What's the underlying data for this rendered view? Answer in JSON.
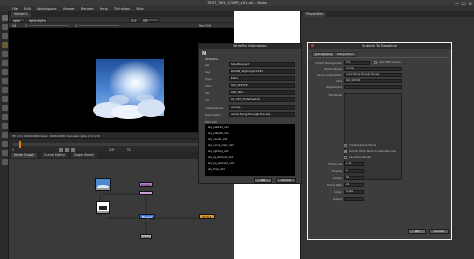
{
  "window": {
    "title": "TEST_SKY_COMP_v01.nk - Nuke",
    "controls": [
      "—",
      "☐",
      "✕"
    ]
  },
  "menubar": [
    "File",
    "Edit",
    "Workspace",
    "Viewer",
    "Render",
    "Help",
    "Thinkbox",
    "Misc"
  ],
  "viewer": {
    "tab_label": "Viewer1",
    "channels": "rgba",
    "channel_value": "rgba.alpha",
    "zoom": "1:1",
    "proxy": "2D",
    "frame": "f/8",
    "gain": "1",
    "gamma": "1",
    "lut": "Rec709",
    "footer": "f/8 | 2:1  1920x1080 bbox: 1920x1080 channels: rgba  x=0 y=0"
  },
  "timeline": {
    "ctrl_labels": [
      "1",
      "24*",
      "TC"
    ]
  },
  "node_graph": {
    "tabs": [
      "Node Graph",
      "Curve Editor",
      "Dope Sheet"
    ],
    "nodes": {
      "read1": "Read1",
      "read2": "Read2",
      "grade": "Grade1",
      "merge": "Merge1",
      "write": "Write1",
      "viewer": "Viewer1"
    }
  },
  "properties": {
    "tab_label": "Properties"
  },
  "info_dialog": {
    "title": "WriteFile Information",
    "logo": "N",
    "section": "WriteFile",
    "fields": [
      {
        "label": "Job",
        "value": "SkyeBuoyant"
      },
      {
        "label": "Seq",
        "value": "DOWN_Skybright-2013"
      },
      {
        "label": "Type",
        "value": "Elem"
      },
      {
        "label": "Shot",
        "value": "SKY_SHOT#"
      },
      {
        "label": "Ver",
        "value": "001_001"
      },
      {
        "label": "Src",
        "value": "01_SKY_FluteFeedv9"
      },
      {
        "label": "Create Name",
        "value": "vcomp"
      },
      {
        "label": "Description",
        "value": "comp flying through the sky"
      },
      {
        "label": "OUT List",
        "value": ""
      }
    ],
    "list_lines": [
      "sky_plate01_v01",
      "sky_plate02_v01",
      "sky_clouds_v02",
      "sky_comp_main_v03",
      "sky_lighting_v01",
      "sky_fg_element_v01",
      "sky_bg_element_v02",
      "sky_final_v04"
    ],
    "buttons": {
      "ok": "OK",
      "cancel": "Cancel"
    }
  },
  "deadline_dialog": {
    "title": "Submit To Deadline",
    "tabs": [
      "Job Options",
      "Integration"
    ],
    "fields": [
      {
        "label": "Project Management",
        "value": "FTL"
      },
      {
        "label": "Version Name",
        "value": "vcomp"
      },
      {
        "label": "Version Description",
        "value": "comp flying through the sky"
      },
      {
        "label": "Shot",
        "value": "SKY_SHOT#"
      },
      {
        "label": "Department",
        "value": ""
      },
      {
        "label": "Thumbnail",
        "value": ""
      }
    ],
    "add_version_label": "Add AMF Version",
    "options": [
      {
        "label": "Create/Upload Movie"
      },
      {
        "label": "Submit Write Node As Separate Jobs"
      },
      {
        "label": "Use Nuke Render"
      }
    ],
    "lower_fields": [
      {
        "label": "Frame List",
        "value": "1-24"
      },
      {
        "label": "Threads",
        "value": "0"
      },
      {
        "label": "Quality",
        "value": "50"
      },
      {
        "label": "Frame Rate",
        "value": "24"
      },
      {
        "label": "Codec",
        "value": "H.264"
      },
      {
        "label": "Output",
        "value": ""
      }
    ],
    "buttons": {
      "ok": "OK",
      "cancel": "Cancel"
    }
  }
}
